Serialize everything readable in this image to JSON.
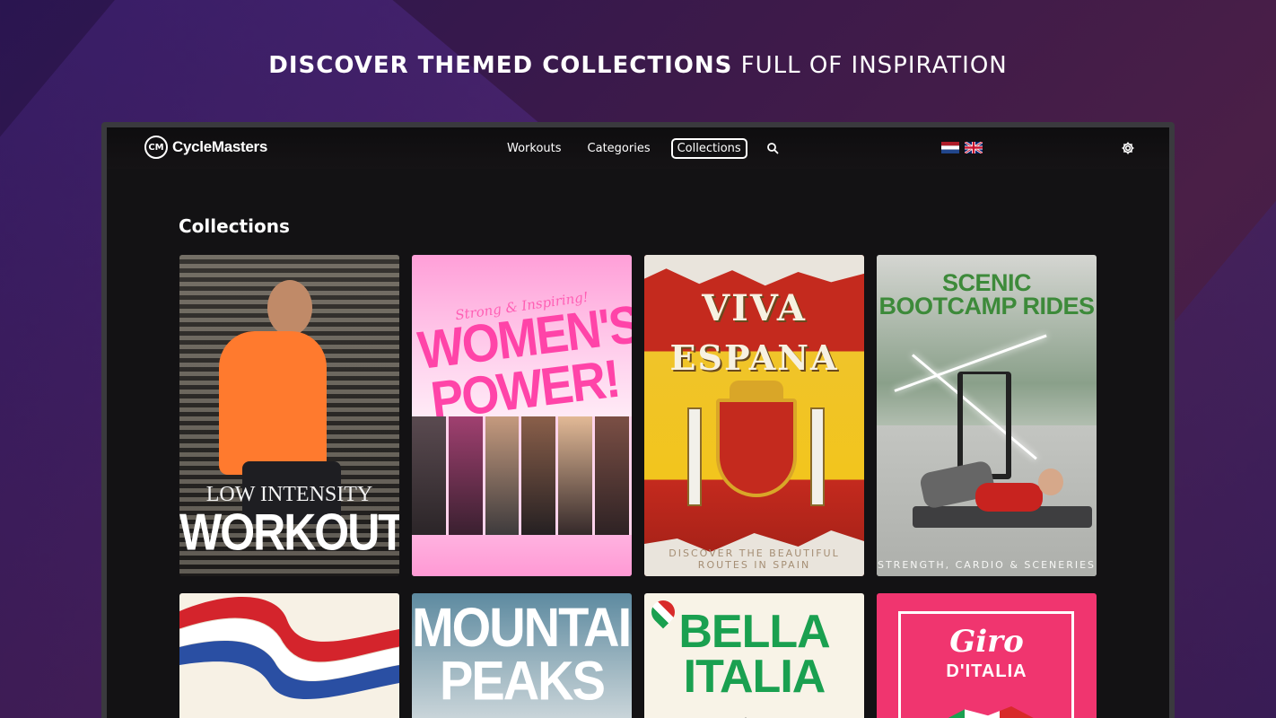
{
  "headline": {
    "bold": "DISCOVER THEMED COLLECTIONS",
    "light": "FULL OF INSPIRATION"
  },
  "app": {
    "brand": "CycleMasters",
    "logo_mark": "CM",
    "nav": [
      {
        "label": "Workouts",
        "active": false
      },
      {
        "label": "Categories",
        "active": false
      },
      {
        "label": "Collections",
        "active": true
      }
    ],
    "icons": {
      "search": "search-icon",
      "settings": "gear-icon",
      "flags": [
        "netherlands-flag-icon",
        "uk-flag-icon"
      ]
    }
  },
  "page": {
    "title": "Collections"
  },
  "collections": [
    {
      "line1": "LOW INTENSITY",
      "line2": "WORKOUTS"
    },
    {
      "tagline": "Strong & Inspiring!",
      "title": "WOMEN'S POWER!"
    },
    {
      "line1": "VIVA",
      "line2": "ESPANA",
      "subtitle": "DISCOVER THE BEAUTIFUL ROUTES IN SPAIN"
    },
    {
      "title": "SCENIC BOOTCAMP RIDES",
      "subtitle": "STRENGTH, CARDIO & SCENERIES"
    },
    {
      "theme": "dutch-ribbon"
    },
    {
      "title": "MOUNTAIN PEAKS"
    },
    {
      "title": "BELLA ITALIA"
    },
    {
      "title": "Giro",
      "subtitle": "D'ITALIA"
    }
  ],
  "colors": {
    "accent_pink": "#ff44a8",
    "italia_green": "#1aa050",
    "giro_pink": "#f0356f"
  }
}
